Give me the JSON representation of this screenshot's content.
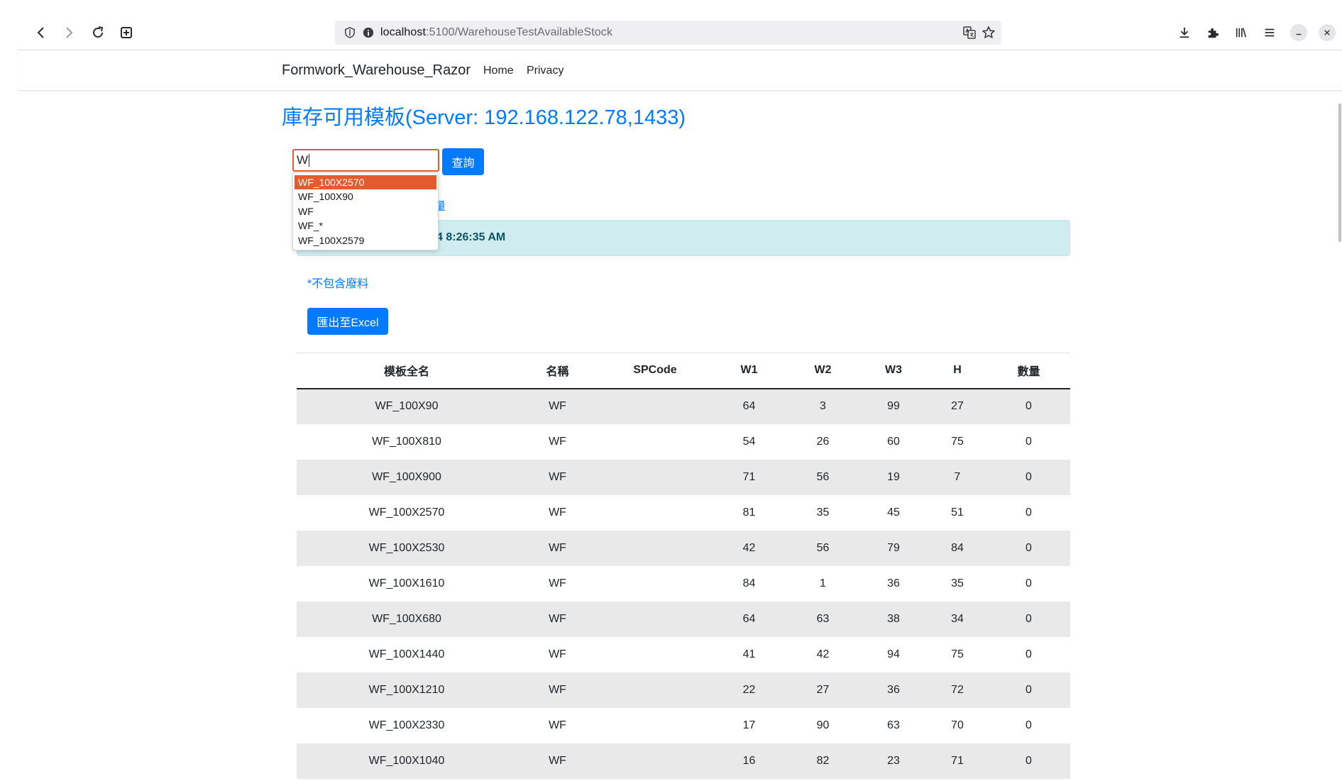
{
  "browser": {
    "url_host": "localhost",
    "url_path": ":5100/WarehouseTestAvailableStock"
  },
  "nav": {
    "brand": "Formwork_Warehouse_Razor",
    "links": [
      "Home",
      "Privacy"
    ]
  },
  "page": {
    "title": "庫存可用模板(Server: 192.168.122.78,1433)",
    "search_value": "W",
    "query_button": "查詢",
    "link_partial": "量",
    "alert_partial": "4 8:26:35 AM",
    "note": "*不包含廢料",
    "export_button": "匯出至Excel"
  },
  "autocomplete": {
    "items": [
      "WF_100X2570",
      "WF_100X90",
      "WF",
      "WF_*",
      "WF_100X2579"
    ],
    "active_index": 0
  },
  "table": {
    "headers": [
      "模板全名",
      "名稱",
      "SPCode",
      "W1",
      "W2",
      "W3",
      "H",
      "數量"
    ],
    "rows": [
      [
        "WF_100X90",
        "WF",
        "",
        "64",
        "3",
        "99",
        "27",
        "0"
      ],
      [
        "WF_100X810",
        "WF",
        "",
        "54",
        "26",
        "60",
        "75",
        "0"
      ],
      [
        "WF_100X900",
        "WF",
        "",
        "71",
        "56",
        "19",
        "7",
        "0"
      ],
      [
        "WF_100X2570",
        "WF",
        "",
        "81",
        "35",
        "45",
        "51",
        "0"
      ],
      [
        "WF_100X2530",
        "WF",
        "",
        "42",
        "56",
        "79",
        "84",
        "0"
      ],
      [
        "WF_100X1610",
        "WF",
        "",
        "84",
        "1",
        "36",
        "35",
        "0"
      ],
      [
        "WF_100X680",
        "WF",
        "",
        "64",
        "63",
        "38",
        "34",
        "0"
      ],
      [
        "WF_100X1440",
        "WF",
        "",
        "41",
        "42",
        "94",
        "75",
        "0"
      ],
      [
        "WF_100X1210",
        "WF",
        "",
        "22",
        "27",
        "36",
        "72",
        "0"
      ],
      [
        "WF_100X2330",
        "WF",
        "",
        "17",
        "90",
        "63",
        "70",
        "0"
      ],
      [
        "WF_100X1040",
        "WF",
        "",
        "16",
        "82",
        "23",
        "71",
        "0"
      ]
    ]
  },
  "colors": {
    "primary": "#007bff",
    "autocomplete_highlight": "#e55b2d",
    "alert_bg": "#d1ecf1",
    "alert_text": "#0c5460",
    "stripe": "#e9e9ea"
  },
  "icons": [
    "back-arrow-icon",
    "forward-arrow-icon",
    "reload-icon",
    "new-tab-icon",
    "shield-icon",
    "info-icon",
    "translate-icon",
    "star-icon",
    "download-icon",
    "extensions-icon",
    "library-icon",
    "menu-icon",
    "minimize-icon",
    "close-icon"
  ]
}
